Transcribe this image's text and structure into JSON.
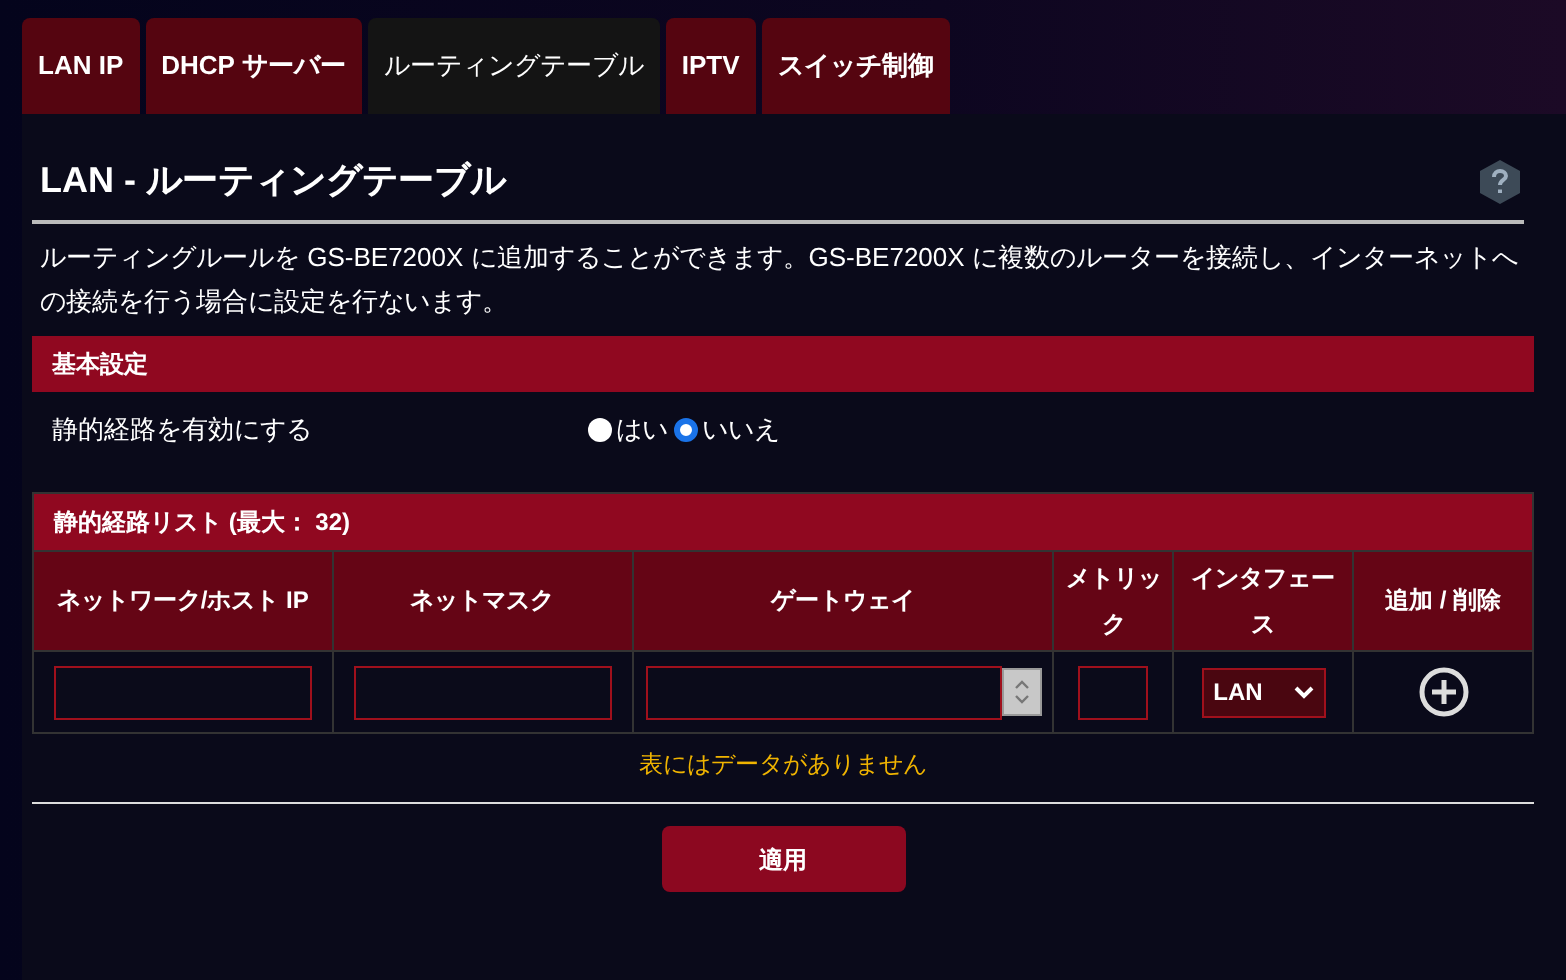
{
  "tabs": [
    {
      "label": "LAN IP",
      "selected": false
    },
    {
      "label": "DHCP サーバー",
      "selected": false
    },
    {
      "label": "ルーティングテーブル",
      "selected": true
    },
    {
      "label": "IPTV",
      "selected": false
    },
    {
      "label": "スイッチ制御",
      "selected": false
    }
  ],
  "title": "LAN - ルーティングテーブル",
  "description": "ルーティングルールを GS-BE7200X に追加することができます。GS-BE7200X に複数のルーターを接続し、インターネットへの接続を行う場合に設定を行ないます。",
  "basic_section": {
    "header": "基本設定",
    "setting_label": "静的経路を有効にする",
    "options": [
      {
        "label": "はい",
        "selected": false
      },
      {
        "label": "いいえ",
        "selected": true
      }
    ]
  },
  "route_list": {
    "header": "静的経路リスト (最大： 32)",
    "columns": [
      "ネットワーク/ホスト IP",
      "ネットマスク",
      "ゲートウェイ",
      "メトリック",
      "インタフェース",
      "追加 / 削除"
    ],
    "input_row": [
      {
        "kind": "text"
      },
      {
        "kind": "text"
      },
      {
        "kind": "combo"
      },
      {
        "kind": "text"
      },
      {
        "kind": "select",
        "value": "LAN"
      },
      {
        "kind": "add"
      }
    ],
    "empty_message": "表にはデータがありません"
  },
  "apply_button": "適用"
}
